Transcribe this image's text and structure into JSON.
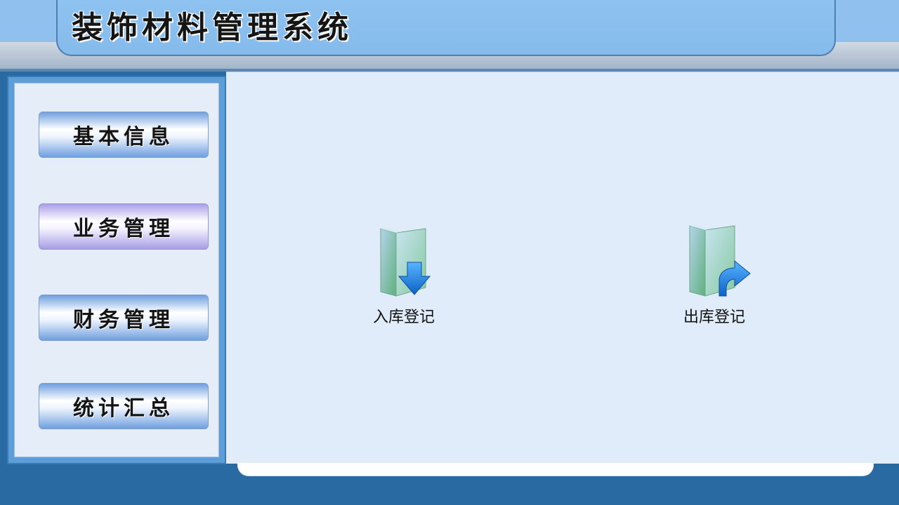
{
  "header": {
    "title": "装饰材料管理系统"
  },
  "sidebar": {
    "items": [
      {
        "label": "基本信息",
        "active": false
      },
      {
        "label": "业务管理",
        "active": true
      },
      {
        "label": "财务管理",
        "active": false
      },
      {
        "label": "统计汇总",
        "active": false
      }
    ]
  },
  "main": {
    "shortcuts": [
      {
        "label": "入库登记",
        "icon": "folder-download-icon"
      },
      {
        "label": "出库登记",
        "icon": "folder-upload-icon"
      }
    ]
  },
  "colors": {
    "header_blue": "#8fc0ee",
    "sidebar_frame": "#5e9ed8",
    "content_bg": "#e1ecfa",
    "page_bg": "#2a6aa3",
    "button_blue": "#6f9fdf",
    "button_active_violet": "#aa9fe7",
    "icon_arrow_blue": "#1c7fe0",
    "folder_green": "#7fc49a"
  }
}
